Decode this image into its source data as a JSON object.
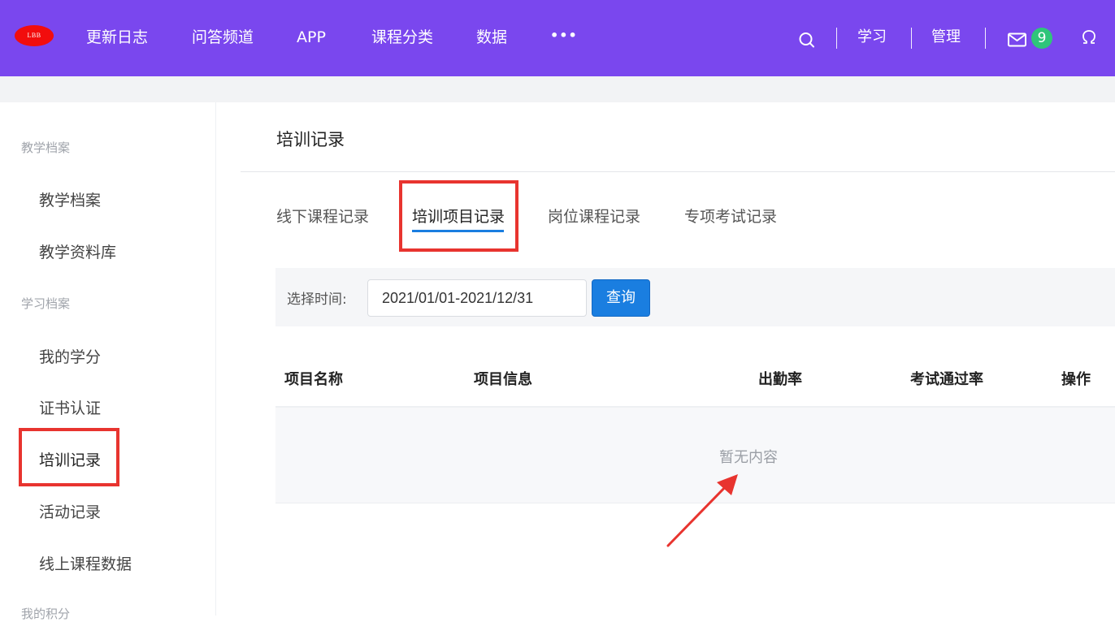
{
  "header": {
    "logo_text": "LBB",
    "nav": [
      {
        "label": "更新日志"
      },
      {
        "label": "问答频道"
      },
      {
        "label": "APP"
      },
      {
        "label": "课程分类"
      },
      {
        "label": "数据"
      },
      {
        "label": "•••"
      }
    ],
    "right": {
      "search_icon": "search-icon",
      "study_label": "学习",
      "manage_label": "管理",
      "mail_icon": "mail-icon",
      "mail_badge": "9",
      "user_icon": "omega-icon"
    },
    "bg_color": "#7a47ee"
  },
  "sidebar": {
    "groups": [
      {
        "title": "教学档案",
        "items": [
          {
            "label": "教学档案"
          },
          {
            "label": "教学资料库"
          }
        ]
      },
      {
        "title": "学习档案",
        "items": [
          {
            "label": "我的学分"
          },
          {
            "label": "证书认证"
          },
          {
            "label": "培训记录"
          },
          {
            "label": "活动记录"
          },
          {
            "label": "线上课程数据"
          }
        ]
      },
      {
        "title": "我的积分",
        "items": []
      }
    ],
    "active": "培训记录"
  },
  "main": {
    "title": "培训记录",
    "tabs": [
      {
        "label": "线下课程记录"
      },
      {
        "label": "培训项目记录"
      },
      {
        "label": "岗位课程记录"
      },
      {
        "label": "专项考试记录"
      }
    ],
    "active_tab": "培训项目记录",
    "filter": {
      "label": "选择时间:",
      "date_value": "2021/01/01-2021/12/31",
      "query_label": "查询"
    },
    "table": {
      "columns": [
        "项目名称",
        "项目信息",
        "出勤率",
        "考试通过率",
        "操作"
      ],
      "empty_text": "暂无内容"
    }
  },
  "colors": {
    "accent": "#1a7ee0",
    "highlight": "#e8342f",
    "badge": "#2fc57a"
  }
}
